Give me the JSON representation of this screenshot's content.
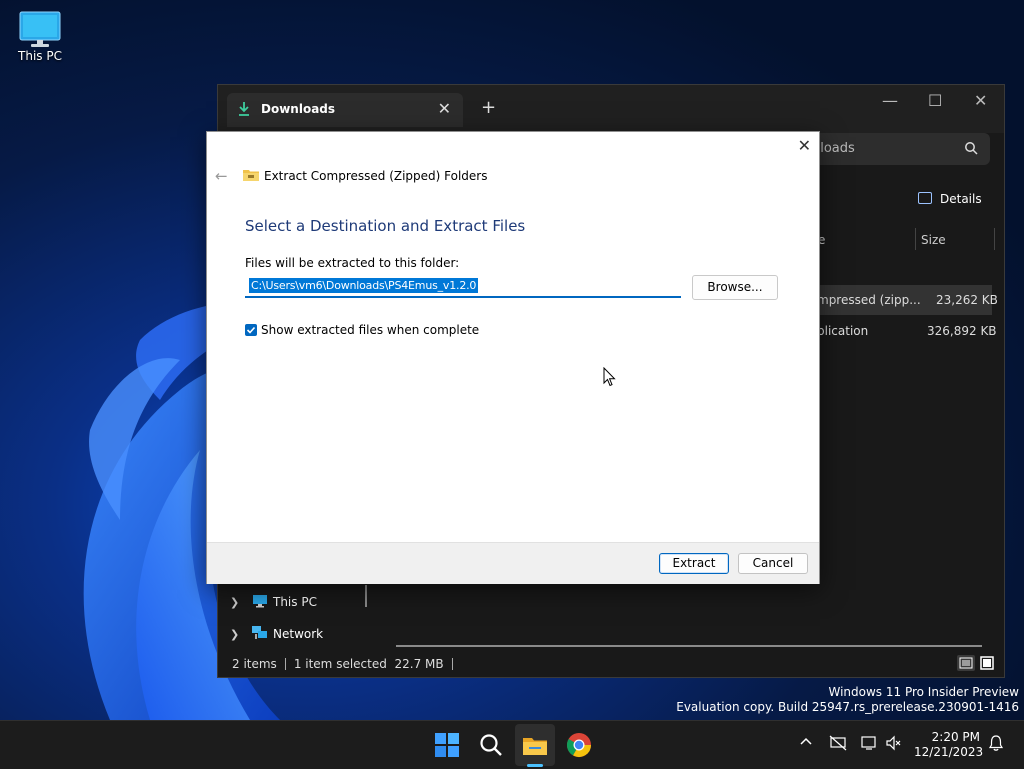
{
  "desktop": {
    "icon_label": "This PC",
    "watermark_line1": "Windows 11 Pro Insider Preview",
    "watermark_line2": "Evaluation copy. Build 25947.rs_prerelease.230901-1416"
  },
  "explorer": {
    "tab_title": "Downloads",
    "search_text": "nloads",
    "details_label": "Details",
    "columns": [
      "e",
      "Size"
    ],
    "files": [
      {
        "type": "mpressed (zipp...",
        "size": "23,262 KB"
      },
      {
        "type": "plication",
        "size": "326,892 KB"
      }
    ],
    "nav": [
      {
        "label": "This PC",
        "icon": "monitor-icon"
      },
      {
        "label": "Network",
        "icon": "network-icon"
      }
    ],
    "status": {
      "items": "2 items",
      "selected": "1 item selected",
      "size": "22.7 MB"
    }
  },
  "dialog": {
    "title": "Extract Compressed (Zipped) Folders",
    "heading": "Select a Destination and Extract Files",
    "folder_label": "Files will be extracted to this folder:",
    "path": "C:\\Users\\vm6\\Downloads\\PS4Emus_v1.2.0",
    "browse_label": "Browse...",
    "checkbox_label": "Show extracted files when complete",
    "checkbox_checked": true,
    "extract_label": "Extract",
    "cancel_label": "Cancel"
  },
  "taskbar": {
    "time": "2:20 PM",
    "date": "12/21/2023",
    "apps": [
      "start-icon",
      "search-icon",
      "file-explorer-icon",
      "chrome-icon"
    ]
  },
  "colors": {
    "accent": "#0067c0",
    "selection": "#0078d7",
    "heading": "#1e3a78"
  }
}
